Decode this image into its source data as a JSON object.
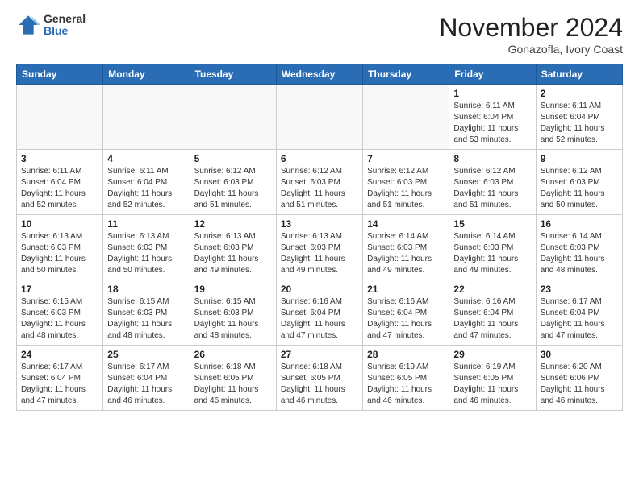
{
  "logo": {
    "general": "General",
    "blue": "Blue"
  },
  "title": {
    "month": "November 2024",
    "location": "Gonazofla, Ivory Coast"
  },
  "weekdays": [
    "Sunday",
    "Monday",
    "Tuesday",
    "Wednesday",
    "Thursday",
    "Friday",
    "Saturday"
  ],
  "weeks": [
    [
      {
        "day": "",
        "info": ""
      },
      {
        "day": "",
        "info": ""
      },
      {
        "day": "",
        "info": ""
      },
      {
        "day": "",
        "info": ""
      },
      {
        "day": "",
        "info": ""
      },
      {
        "day": "1",
        "info": "Sunrise: 6:11 AM\nSunset: 6:04 PM\nDaylight: 11 hours\nand 53 minutes."
      },
      {
        "day": "2",
        "info": "Sunrise: 6:11 AM\nSunset: 6:04 PM\nDaylight: 11 hours\nand 52 minutes."
      }
    ],
    [
      {
        "day": "3",
        "info": "Sunrise: 6:11 AM\nSunset: 6:04 PM\nDaylight: 11 hours\nand 52 minutes."
      },
      {
        "day": "4",
        "info": "Sunrise: 6:11 AM\nSunset: 6:04 PM\nDaylight: 11 hours\nand 52 minutes."
      },
      {
        "day": "5",
        "info": "Sunrise: 6:12 AM\nSunset: 6:03 PM\nDaylight: 11 hours\nand 51 minutes."
      },
      {
        "day": "6",
        "info": "Sunrise: 6:12 AM\nSunset: 6:03 PM\nDaylight: 11 hours\nand 51 minutes."
      },
      {
        "day": "7",
        "info": "Sunrise: 6:12 AM\nSunset: 6:03 PM\nDaylight: 11 hours\nand 51 minutes."
      },
      {
        "day": "8",
        "info": "Sunrise: 6:12 AM\nSunset: 6:03 PM\nDaylight: 11 hours\nand 51 minutes."
      },
      {
        "day": "9",
        "info": "Sunrise: 6:12 AM\nSunset: 6:03 PM\nDaylight: 11 hours\nand 50 minutes."
      }
    ],
    [
      {
        "day": "10",
        "info": "Sunrise: 6:13 AM\nSunset: 6:03 PM\nDaylight: 11 hours\nand 50 minutes."
      },
      {
        "day": "11",
        "info": "Sunrise: 6:13 AM\nSunset: 6:03 PM\nDaylight: 11 hours\nand 50 minutes."
      },
      {
        "day": "12",
        "info": "Sunrise: 6:13 AM\nSunset: 6:03 PM\nDaylight: 11 hours\nand 49 minutes."
      },
      {
        "day": "13",
        "info": "Sunrise: 6:13 AM\nSunset: 6:03 PM\nDaylight: 11 hours\nand 49 minutes."
      },
      {
        "day": "14",
        "info": "Sunrise: 6:14 AM\nSunset: 6:03 PM\nDaylight: 11 hours\nand 49 minutes."
      },
      {
        "day": "15",
        "info": "Sunrise: 6:14 AM\nSunset: 6:03 PM\nDaylight: 11 hours\nand 49 minutes."
      },
      {
        "day": "16",
        "info": "Sunrise: 6:14 AM\nSunset: 6:03 PM\nDaylight: 11 hours\nand 48 minutes."
      }
    ],
    [
      {
        "day": "17",
        "info": "Sunrise: 6:15 AM\nSunset: 6:03 PM\nDaylight: 11 hours\nand 48 minutes."
      },
      {
        "day": "18",
        "info": "Sunrise: 6:15 AM\nSunset: 6:03 PM\nDaylight: 11 hours\nand 48 minutes."
      },
      {
        "day": "19",
        "info": "Sunrise: 6:15 AM\nSunset: 6:03 PM\nDaylight: 11 hours\nand 48 minutes."
      },
      {
        "day": "20",
        "info": "Sunrise: 6:16 AM\nSunset: 6:04 PM\nDaylight: 11 hours\nand 47 minutes."
      },
      {
        "day": "21",
        "info": "Sunrise: 6:16 AM\nSunset: 6:04 PM\nDaylight: 11 hours\nand 47 minutes."
      },
      {
        "day": "22",
        "info": "Sunrise: 6:16 AM\nSunset: 6:04 PM\nDaylight: 11 hours\nand 47 minutes."
      },
      {
        "day": "23",
        "info": "Sunrise: 6:17 AM\nSunset: 6:04 PM\nDaylight: 11 hours\nand 47 minutes."
      }
    ],
    [
      {
        "day": "24",
        "info": "Sunrise: 6:17 AM\nSunset: 6:04 PM\nDaylight: 11 hours\nand 47 minutes."
      },
      {
        "day": "25",
        "info": "Sunrise: 6:17 AM\nSunset: 6:04 PM\nDaylight: 11 hours\nand 46 minutes."
      },
      {
        "day": "26",
        "info": "Sunrise: 6:18 AM\nSunset: 6:05 PM\nDaylight: 11 hours\nand 46 minutes."
      },
      {
        "day": "27",
        "info": "Sunrise: 6:18 AM\nSunset: 6:05 PM\nDaylight: 11 hours\nand 46 minutes."
      },
      {
        "day": "28",
        "info": "Sunrise: 6:19 AM\nSunset: 6:05 PM\nDaylight: 11 hours\nand 46 minutes."
      },
      {
        "day": "29",
        "info": "Sunrise: 6:19 AM\nSunset: 6:05 PM\nDaylight: 11 hours\nand 46 minutes."
      },
      {
        "day": "30",
        "info": "Sunrise: 6:20 AM\nSunset: 6:06 PM\nDaylight: 11 hours\nand 46 minutes."
      }
    ]
  ]
}
